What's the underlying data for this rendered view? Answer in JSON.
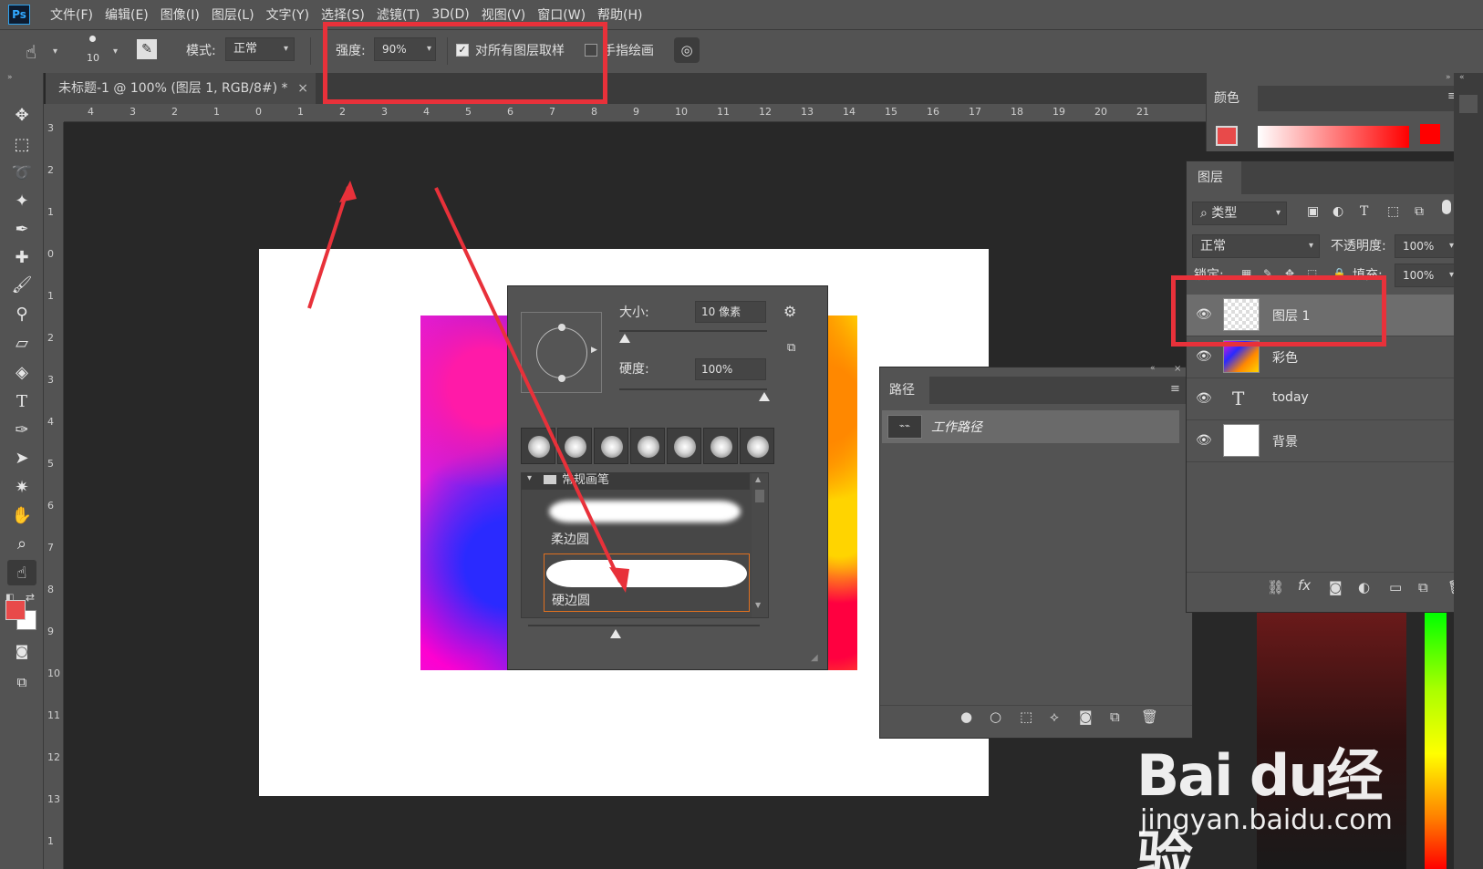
{
  "app": {
    "logo": "Ps"
  },
  "menu": [
    "文件(F)",
    "编辑(E)",
    "图像(I)",
    "图层(L)",
    "文字(Y)",
    "选择(S)",
    "滤镜(T)",
    "3D(D)",
    "视图(V)",
    "窗口(W)",
    "帮助(H)"
  ],
  "options": {
    "brush_size": "10",
    "mode_label": "模式:",
    "mode_value": "正常",
    "strength_label": "强度:",
    "strength_value": "90%",
    "sample_all_label": "对所有图层取样",
    "finger_paint_label": "手指绘画"
  },
  "document_tab": {
    "title": "未标题-1 @ 100% (图层 1, RGB/8#) *",
    "close": "×"
  },
  "ruler_top": [
    "4",
    "3",
    "2",
    "1",
    "0",
    "1",
    "2",
    "3",
    "4",
    "5",
    "6",
    "7",
    "8",
    "9",
    "10",
    "11",
    "12",
    "13",
    "14",
    "15",
    "16",
    "17",
    "18",
    "19",
    "20",
    "21"
  ],
  "ruler_left": [
    "3",
    "2",
    "1",
    "0",
    "1",
    "2",
    "3",
    "4",
    "5",
    "6",
    "7",
    "8",
    "9",
    "10",
    "11",
    "12",
    "13",
    "1"
  ],
  "brush_popup": {
    "size_label": "大小:",
    "size_value": "10 像素",
    "hardness_label": "硬度:",
    "hardness_value": "100%",
    "group_name": "常规画笔",
    "brushes": [
      {
        "name": "柔边圆"
      },
      {
        "name": "硬边圆"
      }
    ]
  },
  "paths_panel": {
    "tab": "路径",
    "items": [
      {
        "name": "工作路径"
      }
    ]
  },
  "color_panel": {
    "tab": "颜色"
  },
  "layers_panel": {
    "tab": "图层",
    "filter_label": "类型",
    "blend_mode": "正常",
    "opacity_label": "不透明度:",
    "opacity_value": "100%",
    "lock_label": "锁定:",
    "fill_label": "填充:",
    "fill_value": "100%",
    "layers": [
      {
        "name": "图层 1",
        "selected": true
      },
      {
        "name": "彩色"
      },
      {
        "name": "today"
      },
      {
        "name": "背景"
      }
    ]
  },
  "colors": {
    "foreground": "#e84a4a",
    "background": "#ffffff",
    "highlight": "#e8313a"
  },
  "watermark": {
    "main": "Bai du经验",
    "sub": "jingyan.baidu.com"
  }
}
